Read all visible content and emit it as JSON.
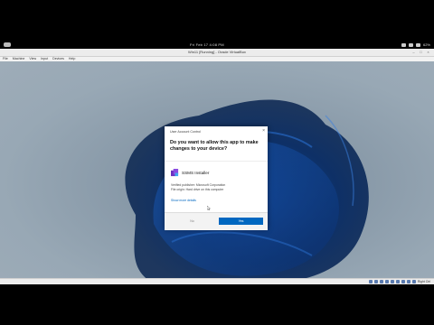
{
  "host_topbar": {
    "clock": "Fri Feb 17  4:08 PM",
    "tray_right": "62%"
  },
  "vbox_window": {
    "title": "Win11 [Running] - Oracle VirtualBox",
    "menu": [
      "File",
      "Machine",
      "View",
      "Input",
      "Devices",
      "Help"
    ],
    "host_key": "Right Ctrl"
  },
  "uac_dialog": {
    "caption": "User Account Control",
    "question": "Do you want to allow this app to make changes to your device?",
    "app_name": "SSMS Installer",
    "publisher_line": "Verified publisher: Microsoft Corporation",
    "origin_line": "File origin: Hard drive on this computer",
    "more_details": "Show more details",
    "no_label": "No",
    "yes_label": "Yes",
    "accent_color": "#0067c0"
  },
  "icons": {
    "app_icon": "ssms-installer-icon",
    "close": "close-icon",
    "cursor": "mouse-pointer-icon"
  }
}
